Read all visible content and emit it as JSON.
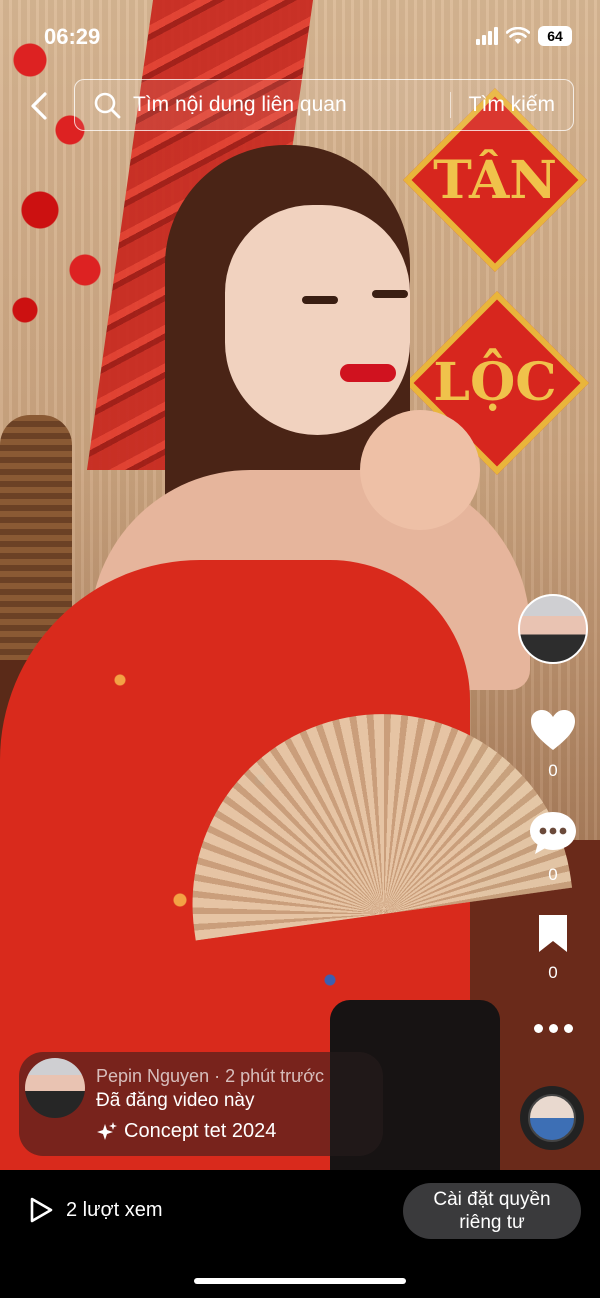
{
  "status_bar": {
    "time": "06:29",
    "battery": "64"
  },
  "search": {
    "placeholder": "Tìm nội dung liên quan",
    "button_label": "Tìm kiếm"
  },
  "background_signs": {
    "top": "TÂN",
    "bottom": "LỘC"
  },
  "actions": {
    "like_count": "0",
    "comment_count": "0",
    "save_count": "0"
  },
  "post": {
    "author": "Pepin Nguyen",
    "time_ago": "2 phút trước",
    "status": "Đã đăng video này",
    "tag": "Concept tet 2024"
  },
  "bottom_bar": {
    "views": "2 lượt xem",
    "privacy_button": "Cài đặt quyền riêng tư"
  },
  "icons": [
    "back-icon",
    "search-icon",
    "heart-icon",
    "comment-icon",
    "bookmark-icon",
    "more-icon",
    "music-disc",
    "sparkle-icon",
    "play-icon"
  ]
}
